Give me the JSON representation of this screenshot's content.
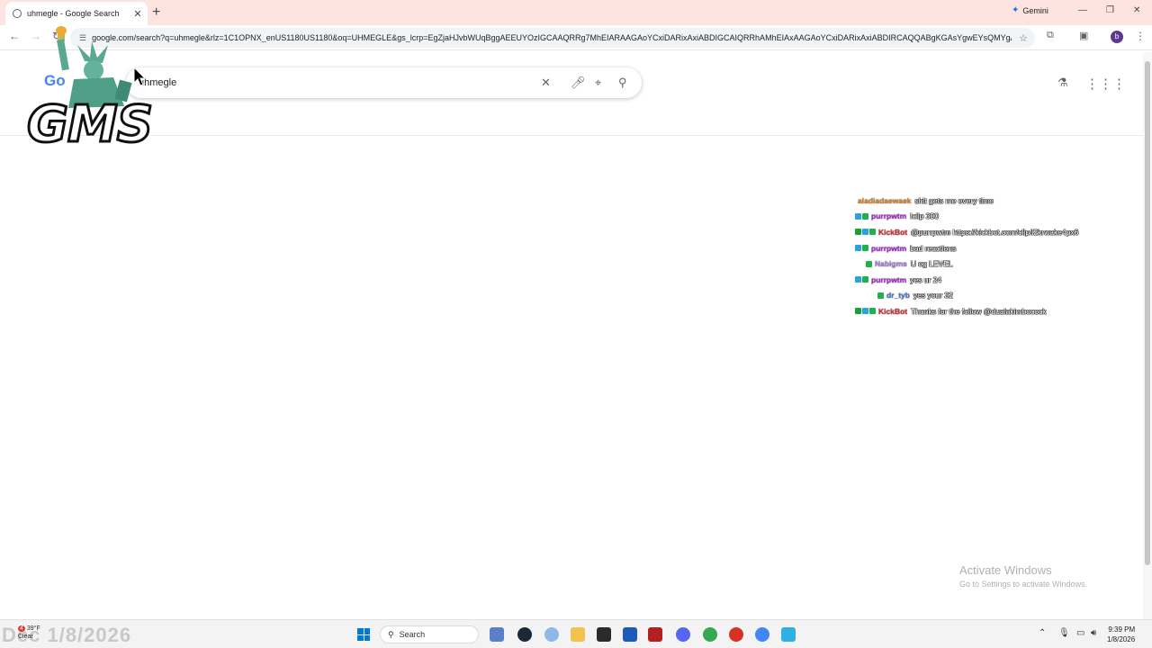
{
  "browser": {
    "tab_title": "uhmegle - Google Search",
    "newtab": "+",
    "gemini_label": "Gemini",
    "url": "google.com/search?q=uhmegle&rlz=1C1OPNX_enUS1180US1180&oq=UHMEGLE&gs_lcrp=EgZjaHJvbWUqBggAEEUYOzIGCAAQRRg7MhEIARAAGAoYCxiDARixAxiABDIGCAIQRRhAMhEIAxAAGAoYCxiDARixAxiABDIRCAQQABgKGAsYgwEYsQMYgA...",
    "profile_initial": "b"
  },
  "google": {
    "logo_partial": "Go",
    "query": "uhmegle"
  },
  "overlay": {
    "logo_text": "GMS"
  },
  "chat": [
    {
      "user": "aladiadaewaek",
      "message": "shit gets me every time",
      "user_color": "#e08a2c",
      "badges": []
    },
    {
      "user": "purrpwtm",
      "message": "!clip 300",
      "user_color": "#b42fd8",
      "badges": [
        "#2aa3d8",
        "#23b04c"
      ]
    },
    {
      "user": "KickBot",
      "message": "@purrpwtm https://kickbot.com/clip/i2krwake4px6",
      "user_color": "#e0323c",
      "badges": [
        "#1a9e3a",
        "#2aa3d8",
        "#23b04c"
      ]
    },
    {
      "user": "purrpwtm",
      "message": "bad reactions",
      "user_color": "#b42fd8",
      "badges": [
        "#2aa3d8",
        "#23b04c"
      ]
    },
    {
      "user": "Nabigms",
      "message": "U og LEVEL",
      "user_color": "#b087e8",
      "badges": [
        "#23b04c"
      ],
      "indent": true
    },
    {
      "user": "purrpwtm",
      "message": "yes ur 24",
      "user_color": "#b42fd8",
      "badges": [
        "#2aa3d8",
        "#23b04c"
      ]
    },
    {
      "user": "dr_tyb",
      "message": "yes your 32",
      "user_color": "#4f7fd8",
      "badges": [
        "#23b04c"
      ],
      "indent2": true
    },
    {
      "user": "KickBot",
      "message": "Thanks for the follow @dualakimbocock",
      "user_color": "#e0323c",
      "badges": [
        "#1a9e3a",
        "#2aa3d8",
        "#23b04c"
      ]
    }
  ],
  "activation": {
    "title": "Activate Windows",
    "subtitle": "Go to Settings to activate Windows."
  },
  "taskbar": {
    "weather_badge": "4",
    "weather_temp": "39°F",
    "weather_cond": "Clear",
    "date_overlay": "Dec 1/8/2026",
    "search_label": "Search",
    "time": "9:39 PM",
    "date": "1/8/2026"
  }
}
